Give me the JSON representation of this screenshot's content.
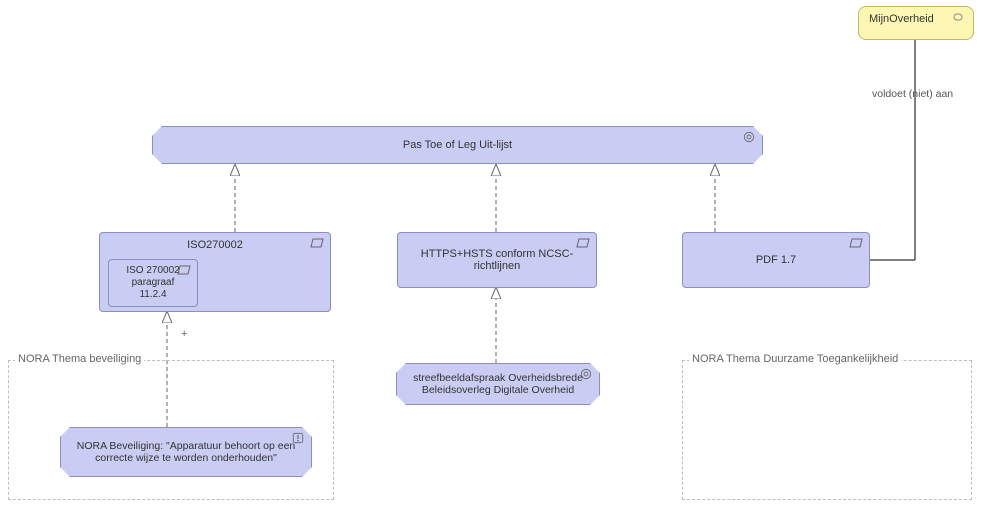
{
  "nodes": {
    "goal_top": {
      "label": "Pas Toe of Leg Uit-lijst"
    },
    "iso": {
      "label": "ISO270002",
      "nested": {
        "l1": "ISO 270002",
        "l2": "paragraaf",
        "l3": "11.2.4"
      }
    },
    "https": {
      "label": "HTTPS+HSTS conform NCSC-richtlijnen"
    },
    "pdf": {
      "label": "PDF 1.7"
    },
    "streef": {
      "label": "streefbeeldafspraak Overheidsbrede Beleidsoverleg Digitale Overheid"
    },
    "nora_beveiliging": {
      "label": "NORA Beveiliging: \"Apparatuur behoort op een correcte wijze te worden onderhouden\""
    },
    "mijn_overheid": {
      "label": "MijnOverheid"
    }
  },
  "groups": {
    "beveiliging": {
      "label": "NORA Thema beveiliging"
    },
    "duurzaam": {
      "label": "NORA Thema Duurzame Toegankelijkheid"
    }
  },
  "relations": {
    "voldoet": "voldoet (niet) aan"
  },
  "colors": {
    "purple_fill": "#c9ccf3",
    "purple_stroke": "#8a8ec2",
    "yellow_fill": "#fdf7b3",
    "yellow_stroke": "#c4bb60",
    "group_border": "#bfbfbf"
  }
}
